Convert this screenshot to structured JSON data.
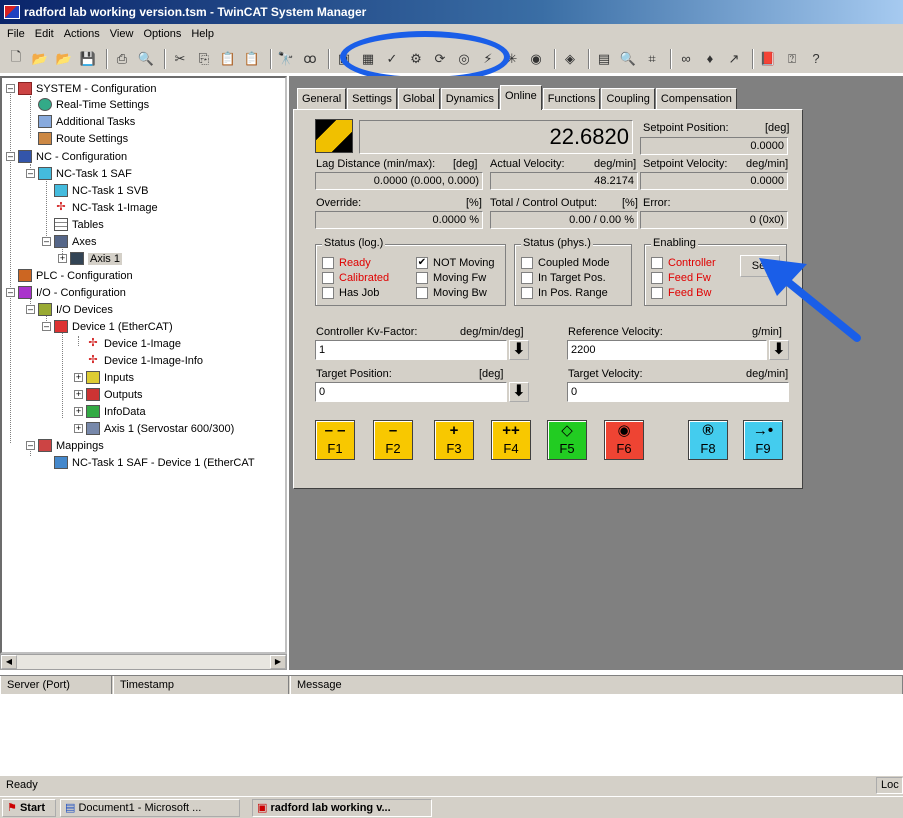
{
  "window": {
    "title": "radford lab working version.tsm - TwinCAT System Manager"
  },
  "menu": [
    "File",
    "Edit",
    "Actions",
    "View",
    "Options",
    "Help"
  ],
  "tree": {
    "system": "SYSTEM - Configuration",
    "realtime": "Real-Time Settings",
    "additional": "Additional Tasks",
    "route": "Route Settings",
    "nc": "NC - Configuration",
    "nctask": "NC-Task 1 SAF",
    "ncsvb": "NC-Task 1 SVB",
    "ncimage": "NC-Task 1-Image",
    "tables": "Tables",
    "axes": "Axes",
    "axis1": "Axis 1",
    "plc": "PLC - Configuration",
    "io": "I/O - Configuration",
    "iodevices": "I/O Devices",
    "device1": "Device 1 (EtherCAT)",
    "dev1image": "Device 1-Image",
    "dev1imageinfo": "Device 1-Image-Info",
    "inputs": "Inputs",
    "outputs": "Outputs",
    "infodata": "InfoData",
    "axisservo": "Axis 1 (Servostar 600/300)",
    "mappings": "Mappings",
    "mapitem": "NC-Task 1 SAF - Device 1 (EtherCAT"
  },
  "tabs": [
    "General",
    "Settings",
    "Global",
    "Dynamics",
    "Online",
    "Functions",
    "Coupling",
    "Compensation"
  ],
  "online": {
    "actual_position": "22.6820",
    "setpoint_position_label": "Setpoint Position:",
    "setpoint_position_unit": "[deg]",
    "setpoint_position": "0.0000",
    "lag_label": "Lag Distance (min/max):",
    "lag_unit": "[deg]",
    "lag_value": "0.0000  (0.000, 0.000)",
    "actual_vel_label": "Actual Velocity:",
    "actual_vel_unit": "deg/min]",
    "actual_vel": "48.2174",
    "setpoint_vel_label": "Setpoint Velocity:",
    "setpoint_vel_unit": "deg/min]",
    "setpoint_vel": "0.0000",
    "override_label": "Override:",
    "override_unit": "[%]",
    "override": "0.0000 %",
    "total_label": "Total / Control Output:",
    "total_unit": "[%]",
    "total": "0.00 /  0.00 %",
    "error_label": "Error:",
    "error": "0 (0x0)",
    "status_log_title": "Status (log.)",
    "ready": "Ready",
    "calibrated": "Calibrated",
    "hasjob": "Has Job",
    "notmoving": "NOT Moving",
    "movingfw": "Moving Fw",
    "movingbw": "Moving Bw",
    "status_phys_title": "Status (phys.)",
    "coupled": "Coupled Mode",
    "intarget": "In Target Pos.",
    "inposrange": "In Pos. Range",
    "enabling_title": "Enabling",
    "controller": "Controller",
    "feedfw": "Feed Fw",
    "feedbw": "Feed Bw",
    "set_button": "Set",
    "kv_label": "Controller Kv-Factor:",
    "kv_unit": "deg/min/deg]",
    "kv_value": "1",
    "refvel_label": "Reference Velocity:",
    "refvel_unit": "g/min]",
    "refvel_value": "2200",
    "targetpos_label": "Target Position:",
    "targetpos_unit": "[deg]",
    "targetpos_value": "0",
    "targetvel_label": "Target Velocity:",
    "targetvel_unit": "deg/min]",
    "targetvel_value": "0"
  },
  "fkeys": {
    "f1": {
      "sym": "– –",
      "label": "F1"
    },
    "f2": {
      "sym": "–",
      "label": "F2"
    },
    "f3": {
      "sym": "+",
      "label": "F3"
    },
    "f4": {
      "sym": "++",
      "label": "F4"
    },
    "f5": {
      "sym": "◇",
      "label": "F5"
    },
    "f6": {
      "sym": "◉",
      "label": "F6"
    },
    "f8": {
      "sym": "®",
      "label": "F8"
    },
    "f9": {
      "sym": "→•",
      "label": "F9"
    }
  },
  "messages": {
    "col_server": "Server (Port)",
    "col_timestamp": "Timestamp",
    "col_message": "Message"
  },
  "status": {
    "text": "Ready",
    "right": "Loc"
  },
  "taskbar": {
    "start": "Start",
    "task1": "Document1 - Microsoft ...",
    "task2": "radford lab working v..."
  },
  "colors": {
    "fkey_yellow": "#f8c800",
    "fkey_green": "#22cc22",
    "fkey_red": "#ee4433",
    "fkey_cyan": "#44ccee",
    "annotation_blue": "#1a5ee8"
  }
}
